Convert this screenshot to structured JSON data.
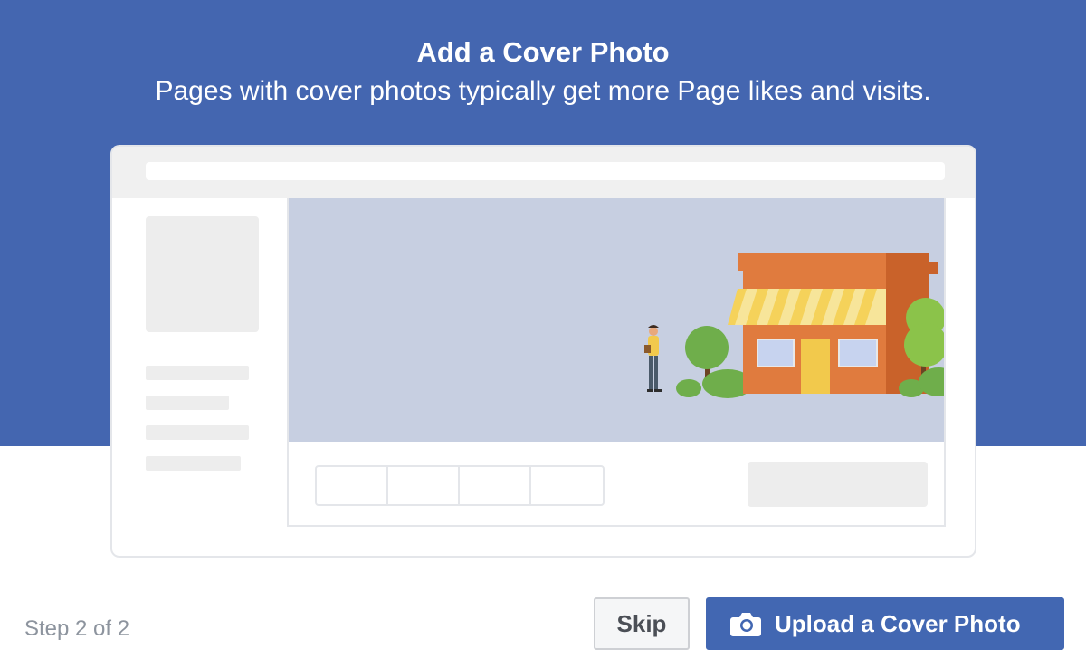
{
  "header": {
    "title": "Add a Cover Photo",
    "subtitle": "Pages with cover photos typically get more Page likes and visits."
  },
  "footer": {
    "step_label": "Step 2 of 2",
    "skip_label": "Skip",
    "upload_label": "Upload a Cover Photo"
  },
  "icons": {
    "upload": "camera-icon"
  },
  "colors": {
    "header_background": "#4466b0",
    "primary_button": "#4267b2",
    "cover_placeholder": "#c7cfe1"
  }
}
